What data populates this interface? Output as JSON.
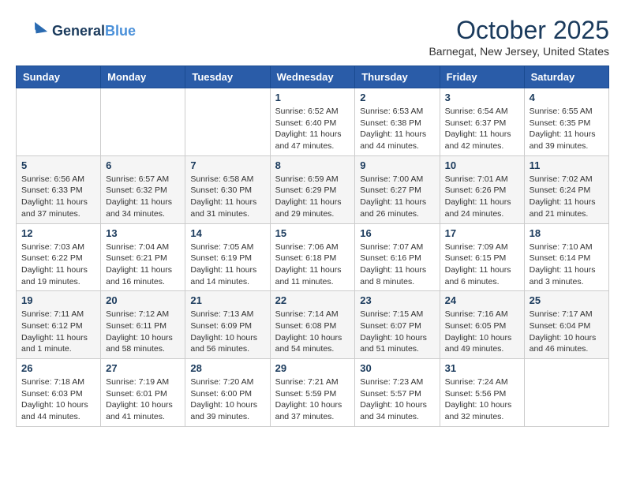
{
  "header": {
    "logo_line1": "General",
    "logo_line2": "Blue",
    "title": "October 2025",
    "subtitle": "Barnegat, New Jersey, United States"
  },
  "weekdays": [
    "Sunday",
    "Monday",
    "Tuesday",
    "Wednesday",
    "Thursday",
    "Friday",
    "Saturday"
  ],
  "weeks": [
    [
      {
        "day": "",
        "info": ""
      },
      {
        "day": "",
        "info": ""
      },
      {
        "day": "",
        "info": ""
      },
      {
        "day": "1",
        "info": "Sunrise: 6:52 AM\nSunset: 6:40 PM\nDaylight: 11 hours and 47 minutes."
      },
      {
        "day": "2",
        "info": "Sunrise: 6:53 AM\nSunset: 6:38 PM\nDaylight: 11 hours and 44 minutes."
      },
      {
        "day": "3",
        "info": "Sunrise: 6:54 AM\nSunset: 6:37 PM\nDaylight: 11 hours and 42 minutes."
      },
      {
        "day": "4",
        "info": "Sunrise: 6:55 AM\nSunset: 6:35 PM\nDaylight: 11 hours and 39 minutes."
      }
    ],
    [
      {
        "day": "5",
        "info": "Sunrise: 6:56 AM\nSunset: 6:33 PM\nDaylight: 11 hours and 37 minutes."
      },
      {
        "day": "6",
        "info": "Sunrise: 6:57 AM\nSunset: 6:32 PM\nDaylight: 11 hours and 34 minutes."
      },
      {
        "day": "7",
        "info": "Sunrise: 6:58 AM\nSunset: 6:30 PM\nDaylight: 11 hours and 31 minutes."
      },
      {
        "day": "8",
        "info": "Sunrise: 6:59 AM\nSunset: 6:29 PM\nDaylight: 11 hours and 29 minutes."
      },
      {
        "day": "9",
        "info": "Sunrise: 7:00 AM\nSunset: 6:27 PM\nDaylight: 11 hours and 26 minutes."
      },
      {
        "day": "10",
        "info": "Sunrise: 7:01 AM\nSunset: 6:26 PM\nDaylight: 11 hours and 24 minutes."
      },
      {
        "day": "11",
        "info": "Sunrise: 7:02 AM\nSunset: 6:24 PM\nDaylight: 11 hours and 21 minutes."
      }
    ],
    [
      {
        "day": "12",
        "info": "Sunrise: 7:03 AM\nSunset: 6:22 PM\nDaylight: 11 hours and 19 minutes."
      },
      {
        "day": "13",
        "info": "Sunrise: 7:04 AM\nSunset: 6:21 PM\nDaylight: 11 hours and 16 minutes."
      },
      {
        "day": "14",
        "info": "Sunrise: 7:05 AM\nSunset: 6:19 PM\nDaylight: 11 hours and 14 minutes."
      },
      {
        "day": "15",
        "info": "Sunrise: 7:06 AM\nSunset: 6:18 PM\nDaylight: 11 hours and 11 minutes."
      },
      {
        "day": "16",
        "info": "Sunrise: 7:07 AM\nSunset: 6:16 PM\nDaylight: 11 hours and 8 minutes."
      },
      {
        "day": "17",
        "info": "Sunrise: 7:09 AM\nSunset: 6:15 PM\nDaylight: 11 hours and 6 minutes."
      },
      {
        "day": "18",
        "info": "Sunrise: 7:10 AM\nSunset: 6:14 PM\nDaylight: 11 hours and 3 minutes."
      }
    ],
    [
      {
        "day": "19",
        "info": "Sunrise: 7:11 AM\nSunset: 6:12 PM\nDaylight: 11 hours and 1 minute."
      },
      {
        "day": "20",
        "info": "Sunrise: 7:12 AM\nSunset: 6:11 PM\nDaylight: 10 hours and 58 minutes."
      },
      {
        "day": "21",
        "info": "Sunrise: 7:13 AM\nSunset: 6:09 PM\nDaylight: 10 hours and 56 minutes."
      },
      {
        "day": "22",
        "info": "Sunrise: 7:14 AM\nSunset: 6:08 PM\nDaylight: 10 hours and 54 minutes."
      },
      {
        "day": "23",
        "info": "Sunrise: 7:15 AM\nSunset: 6:07 PM\nDaylight: 10 hours and 51 minutes."
      },
      {
        "day": "24",
        "info": "Sunrise: 7:16 AM\nSunset: 6:05 PM\nDaylight: 10 hours and 49 minutes."
      },
      {
        "day": "25",
        "info": "Sunrise: 7:17 AM\nSunset: 6:04 PM\nDaylight: 10 hours and 46 minutes."
      }
    ],
    [
      {
        "day": "26",
        "info": "Sunrise: 7:18 AM\nSunset: 6:03 PM\nDaylight: 10 hours and 44 minutes."
      },
      {
        "day": "27",
        "info": "Sunrise: 7:19 AM\nSunset: 6:01 PM\nDaylight: 10 hours and 41 minutes."
      },
      {
        "day": "28",
        "info": "Sunrise: 7:20 AM\nSunset: 6:00 PM\nDaylight: 10 hours and 39 minutes."
      },
      {
        "day": "29",
        "info": "Sunrise: 7:21 AM\nSunset: 5:59 PM\nDaylight: 10 hours and 37 minutes."
      },
      {
        "day": "30",
        "info": "Sunrise: 7:23 AM\nSunset: 5:57 PM\nDaylight: 10 hours and 34 minutes."
      },
      {
        "day": "31",
        "info": "Sunrise: 7:24 AM\nSunset: 5:56 PM\nDaylight: 10 hours and 32 minutes."
      },
      {
        "day": "",
        "info": ""
      }
    ]
  ]
}
